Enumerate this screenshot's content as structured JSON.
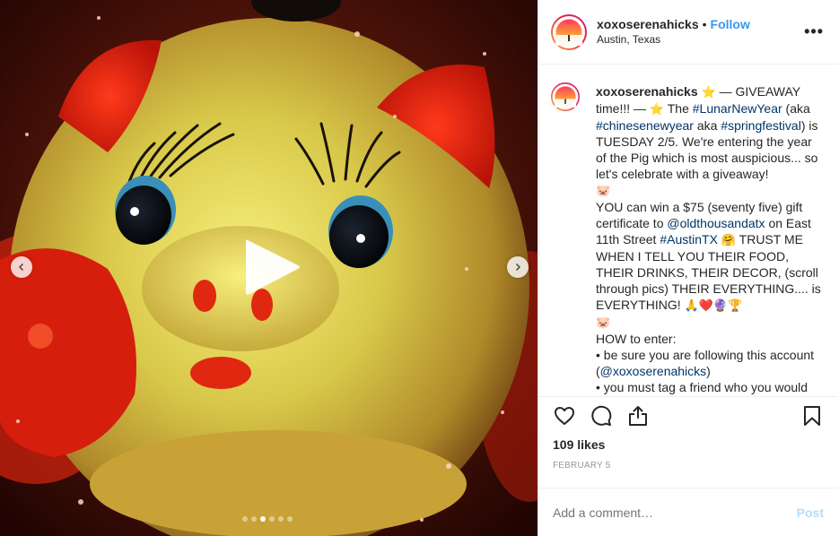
{
  "media": {
    "icons": {
      "prev": "chevron-left-icon",
      "next": "chevron-right-icon",
      "play": "play-icon"
    },
    "carousel": {
      "total": 6,
      "active_index": 3
    }
  },
  "header": {
    "username": "xoxoserenahicks",
    "separator": "•",
    "follow_label": "Follow",
    "location": "Austin, Texas",
    "more_label": "•••"
  },
  "caption": {
    "username": "xoxoserenahicks",
    "star1": "⭐",
    "t1": " — GIVEAWAY time!!! — ",
    "star2": "⭐",
    "t2": " The ",
    "tag1": "#LunarNewYear",
    "t3": " (aka ",
    "tag2": "#chinesenewyear",
    "t4": " aka ",
    "tag3": "#springfestival",
    "t5": ") is TUESDAY 2/5. We're entering the year of the Pig which is most auspicious... so let's celebrate with a giveaway!",
    "pig1": "🐷",
    "t6": "YOU can win a $75 (seventy five) gift certificate to ",
    "tag4": "@oldthousandatx",
    "t7": " on East 11th Street ",
    "tag5": "#AustinTX",
    "hug": "🤗",
    "t8": " TRUST ME WHEN I TELL YOU THEIR FOOD, THEIR DRINKS, THEIR DECOR, (scroll through pics) THEIR EVERYTHING.... is EVERYTHING! ",
    "emojis": "🙏❤️🔮🏆",
    "pig2": "🐷",
    "t9": "HOW to enter:",
    "t10": "• be sure you are following this account (",
    "tag6": "@xoxoserenahicks",
    "t11": ")",
    "t12": "• you must tag a friend who you would"
  },
  "actions": {
    "like_icon": "heart-icon",
    "comment_icon": "comment-icon",
    "share_icon": "share-icon",
    "save_icon": "bookmark-icon"
  },
  "likes": "109 likes",
  "date": "FEBRUARY 5",
  "comment": {
    "placeholder": "Add a comment…",
    "post_label": "Post"
  },
  "colors": {
    "link": "#3897f0",
    "hashtag": "#003569",
    "muted": "#999999",
    "post_disabled": "#b2dffc"
  }
}
